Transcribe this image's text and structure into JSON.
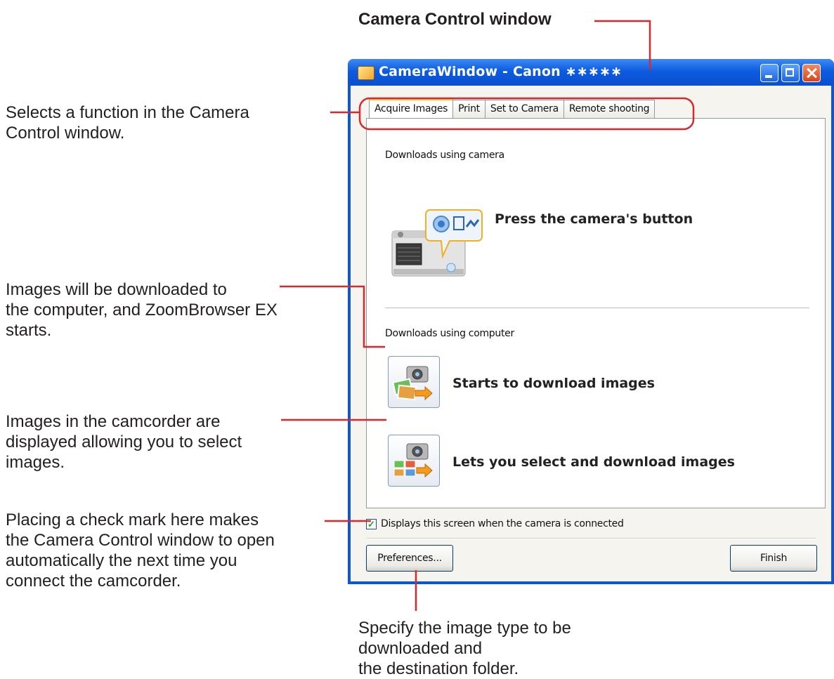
{
  "callouts": {
    "title": "Camera Control window",
    "tabs_note": [
      "Selects a function in the Camera",
      "Control window."
    ],
    "download_note": [
      "Images will be downloaded to",
      "the computer, and ZoomBrowser EX",
      "starts."
    ],
    "select_note": [
      "Images in the camcorder are",
      "displayed allowing you to select",
      "images."
    ],
    "checkbox_note": [
      "Placing a check mark here makes",
      "the Camera Control window to open",
      "automatically the next time you",
      "connect the camcorder."
    ],
    "preferences_note": [
      "Specify the image type to be downloaded and",
      "the destination folder."
    ]
  },
  "window": {
    "title": "CameraWindow - Canon ∗∗∗∗∗",
    "tabs": [
      {
        "label": "Acquire Images",
        "active": true
      },
      {
        "label": "Print",
        "active": false
      },
      {
        "label": "Set to Camera",
        "active": false
      },
      {
        "label": "Remote shooting",
        "active": false
      }
    ],
    "section_camera": "Downloads using camera",
    "camera_action": "Press the camera's button",
    "section_computer": "Downloads using computer",
    "download_action": "Starts to download images",
    "select_action": "Lets you select and download images",
    "checkbox_label": "Displays this screen when the camera is connected",
    "checkbox_checked": true,
    "preferences_button": "Preferences...",
    "finish_button": "Finish"
  },
  "colors": {
    "callout_line": "#d7282f",
    "titlebar": "#0a58d6"
  }
}
